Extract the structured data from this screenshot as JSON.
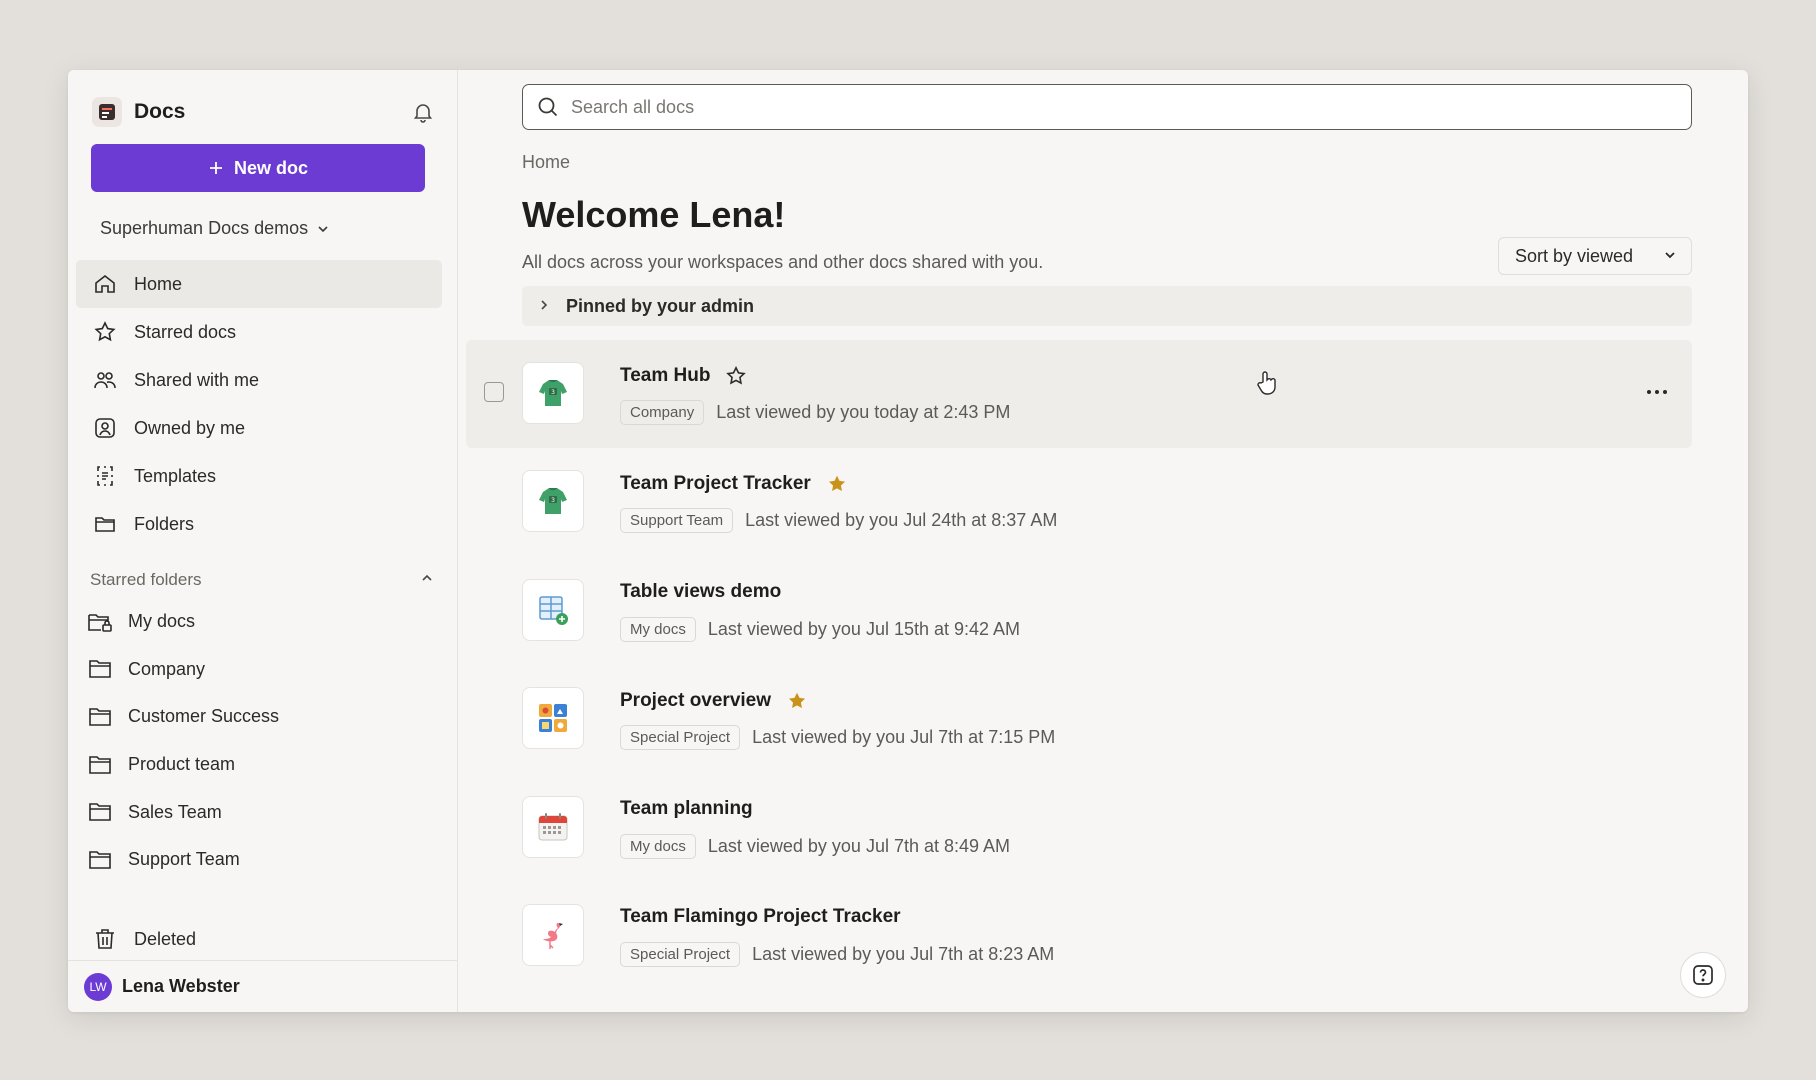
{
  "app": {
    "title": "Docs"
  },
  "sidebar": {
    "new_doc_label": "New doc",
    "workspace": "Superhuman Docs demos",
    "nav": [
      {
        "label": "Home",
        "icon": "home-icon",
        "active": true
      },
      {
        "label": "Starred docs",
        "icon": "star-icon"
      },
      {
        "label": "Shared with me",
        "icon": "people-icon"
      },
      {
        "label": "Owned by me",
        "icon": "person-icon"
      },
      {
        "label": "Templates",
        "icon": "templates-icon"
      },
      {
        "label": "Folders",
        "icon": "folder-icon"
      }
    ],
    "starred_folders_title": "Starred folders",
    "starred_folders": [
      {
        "label": "My docs",
        "icon": "lock-folder-icon"
      },
      {
        "label": "Company",
        "icon": "folder-icon"
      },
      {
        "label": "Customer Success",
        "icon": "folder-icon"
      },
      {
        "label": "Product team",
        "icon": "folder-icon"
      },
      {
        "label": "Sales Team",
        "icon": "folder-icon"
      },
      {
        "label": "Support Team",
        "icon": "folder-icon"
      }
    ],
    "deleted_label": "Deleted",
    "user": {
      "initials": "LW",
      "name": "Lena Webster"
    }
  },
  "main": {
    "search_placeholder": "Search all docs",
    "breadcrumb": "Home",
    "welcome": "Welcome Lena!",
    "subtitle": "All docs across your workspaces and other docs shared with you.",
    "sort_label": "Sort by viewed",
    "pinned_label": "Pinned by your admin",
    "docs": [
      {
        "title": "Team Hub",
        "starred": false,
        "tag": "Company",
        "viewed": "Last viewed by you today at 2:43 PM",
        "icon": "green-shirt-icon"
      },
      {
        "title": "Team Project Tracker",
        "starred": true,
        "tag": "Support Team",
        "viewed": "Last viewed by you Jul 24th at 8:37 AM",
        "icon": "green-shirt-icon"
      },
      {
        "title": "Table views demo",
        "starred": false,
        "tag": "My docs",
        "viewed": "Last viewed by you Jul 15th at 9:42 AM",
        "icon": "table-add-icon"
      },
      {
        "title": "Project overview",
        "starred": true,
        "tag": "Special Project",
        "viewed": "Last viewed by you Jul 7th at 7:15 PM",
        "icon": "grid-tiles-icon"
      },
      {
        "title": "Team planning",
        "starred": false,
        "tag": "My docs",
        "viewed": "Last viewed by you Jul 7th at 8:49 AM",
        "icon": "calendar-icon"
      },
      {
        "title": "Team Flamingo Project Tracker",
        "starred": false,
        "tag": "Special Project",
        "viewed": "Last viewed by you Jul 7th at 8:23 AM",
        "icon": "flamingo-icon"
      }
    ]
  },
  "colors": {
    "accent": "#6b3bd4",
    "star": "#c9931a",
    "background": "#f7f6f4"
  }
}
